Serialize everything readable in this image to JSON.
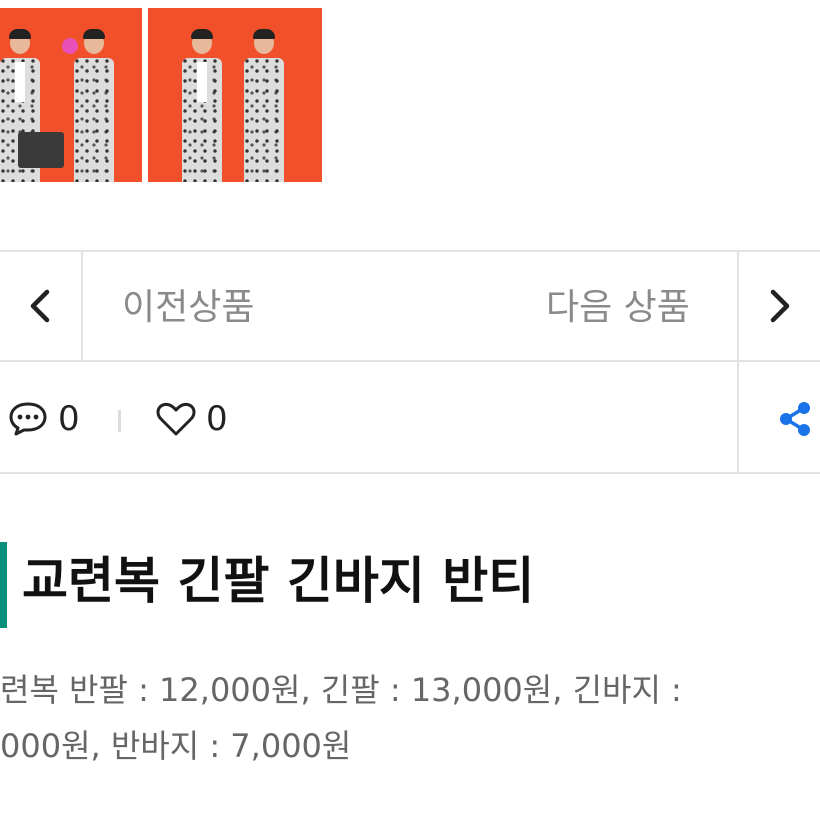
{
  "navigation": {
    "prev_label": "이전상품",
    "next_label": "다음 상품"
  },
  "engagement": {
    "comment_count": "0",
    "like_count": "0"
  },
  "product": {
    "title": "교련복 긴팔 긴바지 반티",
    "description_line1": "련복 반팔 : 12,000원, 긴팔 : 13,000원, 긴바지 :",
    "description_line2": "000원, 반바지 : 7,000원"
  },
  "colors": {
    "accent": "#0c8f7a",
    "share": "#1a73e8",
    "photo_bg": "#f1502a"
  },
  "icons": {
    "prev": "chevron-left-icon",
    "next": "chevron-right-icon",
    "comment": "speech-bubble-icon",
    "like": "heart-icon",
    "share": "share-icon"
  }
}
